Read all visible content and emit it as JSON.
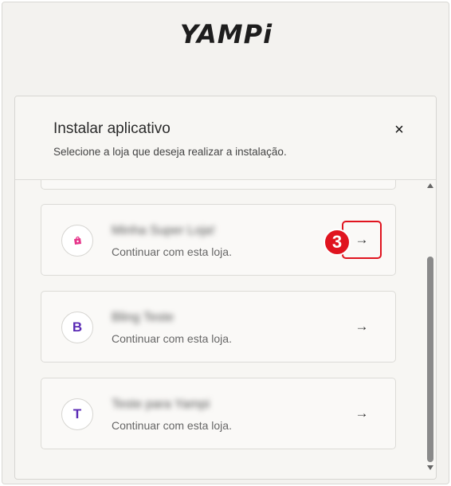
{
  "brand": {
    "logo_text": "YAMPi"
  },
  "modal": {
    "title": "Instalar aplicativo",
    "subtitle": "Selecione a loja que deseja realizar a instalação.",
    "close_icon": "×"
  },
  "stores": [
    {
      "name": "Minha Super Loja!",
      "subtitle": "Continuar com esta loja.",
      "avatar_icon": "shopping-bag-icon",
      "avatar_letter": "",
      "arrow": "→"
    },
    {
      "name": "Bling Teste",
      "subtitle": "Continuar com esta loja.",
      "avatar_letter": "B",
      "arrow": "→"
    },
    {
      "name": "Teste para Yampi",
      "subtitle": "Continuar com esta loja.",
      "avatar_letter": "T",
      "arrow": "→"
    }
  ],
  "annotation": {
    "step_number": "3"
  },
  "colors": {
    "accent": "#5b2bb5",
    "highlight": "#e0141f",
    "bag_pink": "#e6358a"
  }
}
